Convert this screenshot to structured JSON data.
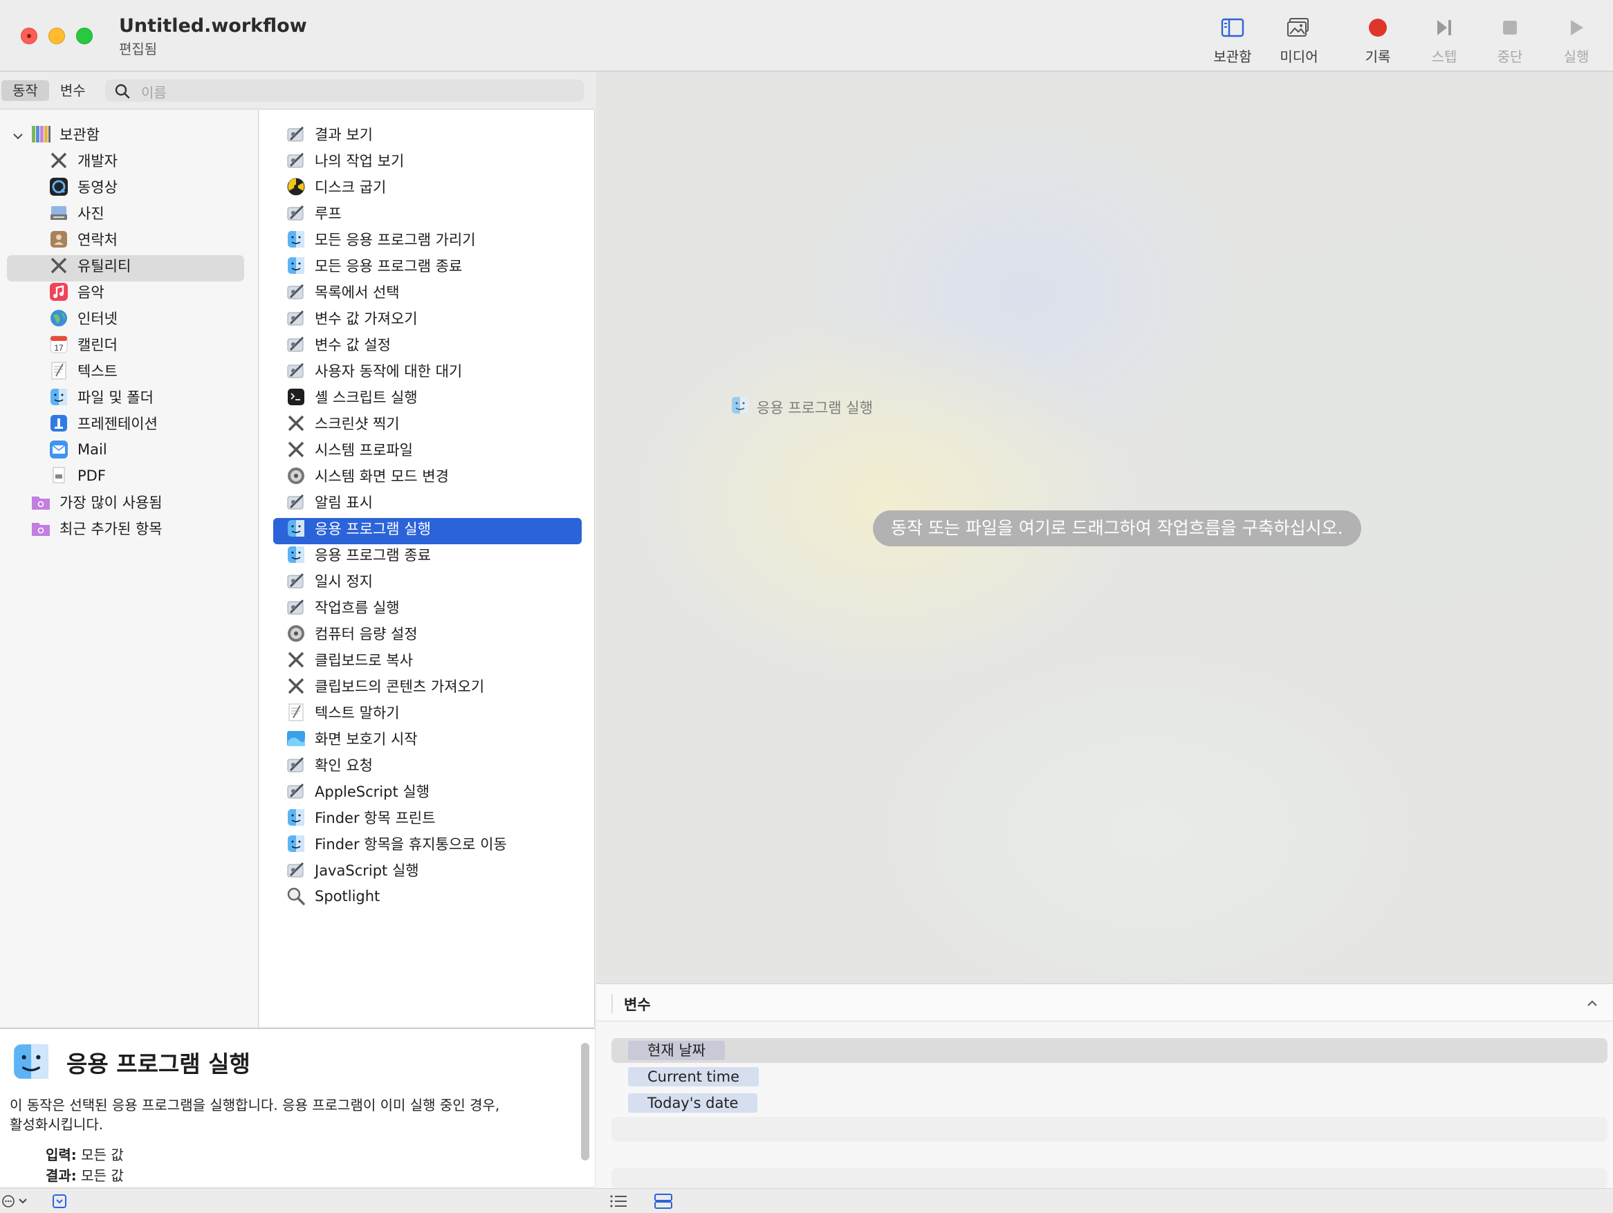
{
  "window": {
    "title": "Untitled.workflow",
    "subtitle": "편집됨"
  },
  "toolbar": {
    "library": "보관함",
    "media": "미디어",
    "record": "기록",
    "step": "스텝",
    "stop": "중단",
    "run": "실행"
  },
  "tabs": {
    "actions": "동작",
    "variables": "변수"
  },
  "search": {
    "placeholder": "이름"
  },
  "library": {
    "root": "보관함",
    "items": [
      "개발자",
      "동영상",
      "사진",
      "연락처",
      "유틸리티",
      "음악",
      "인터넷",
      "캘린더",
      "텍스트",
      "파일 및 폴더",
      "프레젠테이션",
      "Mail",
      "PDF"
    ],
    "smart": [
      "가장 많이 사용됨",
      "최근 추가된 항목"
    ]
  },
  "actions": [
    "결과 보기",
    "나의 작업 보기",
    "디스크 굽기",
    "루프",
    "모든 응용 프로그램 가리기",
    "모든 응용 프로그램 종료",
    "목록에서 선택",
    "변수 값 가져오기",
    "변수 값 설정",
    "사용자 동작에 대한 대기",
    "셸 스크립트 실행",
    "스크린샷 찍기",
    "시스템 프로파일",
    "시스템 화면 모드 변경",
    "알림 표시",
    "응용 프로그램 실행",
    "응용 프로그램 종료",
    "일시 정지",
    "작업흐름 실행",
    "컴퓨터 음량 설정",
    "클립보드로 복사",
    "클립보드의 콘텐츠 가져오기",
    "텍스트 말하기",
    "화면 보호기 시작",
    "확인 요청",
    "AppleScript 실행",
    "Finder 항목 프린트",
    "Finder 항목을 휴지통으로 이동",
    "JavaScript 실행",
    "Spotlight"
  ],
  "description": {
    "title": "응용 프로그램 실행",
    "body": "이 동작은 선택된 응용 프로그램을 실행합니다. 응용 프로그램이 이미 실행 중인 경우, 활성화시킵니다.",
    "input_label": "입력:",
    "input_value": "모든 값",
    "result_label": "결과:",
    "result_value": "모든 값"
  },
  "canvas": {
    "drag_label": "응용 프로그램 실행",
    "hint": "동작 또는 파일을 여기로 드래그하여 작업흐름을 구축하십시오."
  },
  "variables": {
    "title": "변수",
    "items": [
      "현재 날짜",
      "Current time",
      "Today's date"
    ]
  },
  "colors": {
    "accent": "#2b63d9",
    "record": "#e0352b"
  }
}
